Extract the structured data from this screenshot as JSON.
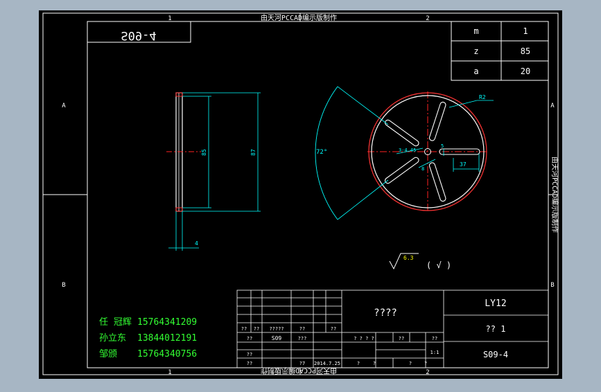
{
  "colors": {
    "background": "#a7b6c4",
    "canvas": "#000000",
    "frame": "#ffffff",
    "text": "#ffffff",
    "green": "#33ff33",
    "cyan": "#00ffff",
    "red": "#ff2222",
    "yellow": "#ffff00"
  },
  "watermark": "由天河PCCAD编示版制作",
  "border": {
    "top_zones": [
      "1",
      "2"
    ],
    "bottom_zones": [
      "1",
      "2"
    ],
    "left_zones": [
      "A",
      "B"
    ],
    "right_zones": [
      "A",
      "B"
    ]
  },
  "part_code_mirror": "S09-4",
  "params": [
    {
      "name": "m",
      "value": "1"
    },
    {
      "name": "z",
      "value": "85"
    },
    {
      "name": "a",
      "value": "20"
    }
  ],
  "dims": {
    "inner": "85",
    "outer": "87",
    "thickness": "4",
    "angle": "72°",
    "slot_len": "37",
    "slot_w": "5",
    "hole_d": "8",
    "hole_mark": "3-4.45",
    "arc_r": "R2",
    "rough_main": "6.3",
    "rough_paren": "( √ )"
  },
  "designers": [
    {
      "name": "任 冠辉",
      "phone": "15764341209"
    },
    {
      "name": "孙立东",
      "phone": "13844012191"
    },
    {
      "name": "邹颁",
      "phone": "15764340756"
    }
  ],
  "title_block": {
    "part_name": "????",
    "material": "LY12",
    "qty": "?? 1",
    "drawing_no": "S09-4",
    "cells": {
      "c_a": "??",
      "c_b": "??",
      "c_c": "?????",
      "c_d": "??",
      "c_e": "??",
      "c_code": "S09",
      "c_f": "???",
      "c_stage": "? ? ? ?",
      "c_g": "??",
      "c_h": "??",
      "c_i": "??",
      "c_scale": "1:1",
      "c_j": "??",
      "c_k": "??",
      "c_l": "?7",
      "c_date": "2014.7.25",
      "c_m": "?",
      "c_n": "?",
      "c_o": "?",
      "c_p": "?"
    }
  }
}
